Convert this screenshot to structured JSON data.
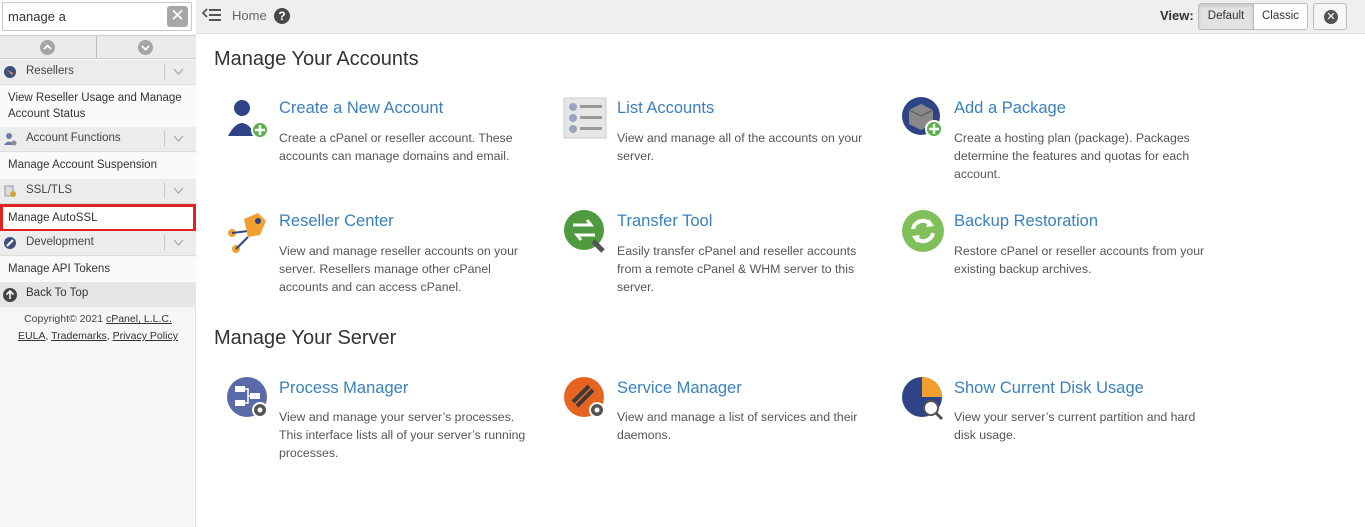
{
  "sidebar": {
    "search_value": "manage a",
    "categories": [
      {
        "label": "Resellers",
        "item": "View Reseller Usage and Manage Account Status"
      },
      {
        "label": "Account Functions",
        "item": "Manage Account Suspension"
      },
      {
        "label": "SSL/TLS",
        "item": "Manage AutoSSL"
      },
      {
        "label": "Development",
        "item": "Manage API Tokens"
      }
    ],
    "back_to_top": "Back To Top",
    "copyright": "Copyright© 2021",
    "company_link": "cPanel, L.L.C.",
    "footer_links": [
      "EULA",
      "Trademarks",
      "Privacy Policy"
    ]
  },
  "topbar": {
    "breadcrumb": "Home",
    "help_glyph": "?",
    "view_label": "View:",
    "view_options": [
      "Default",
      "Classic"
    ],
    "selected_view": "Default"
  },
  "sections": [
    {
      "title": "Manage Your Accounts",
      "tiles": [
        {
          "title": "Create a New Account",
          "desc": "Create a cPanel or reseller account. These accounts can manage domains and email.",
          "icon": "create-account-icon"
        },
        {
          "title": "List Accounts",
          "desc": "View and manage all of the accounts on your server.",
          "icon": "list-accounts-icon"
        },
        {
          "title": "Add a Package",
          "desc": "Create a hosting plan (package). Packages determine the features and quotas for each account.",
          "icon": "add-package-icon"
        },
        {
          "title": "Reseller Center",
          "desc": "View and manage reseller accounts on your server. Resellers manage other cPanel accounts and can access cPanel.",
          "icon": "reseller-center-icon"
        },
        {
          "title": "Transfer Tool",
          "desc": "Easily transfer cPanel and reseller accounts from a remote cPanel & WHM server to this server.",
          "icon": "transfer-tool-icon"
        },
        {
          "title": "Backup Restoration",
          "desc": "Restore cPanel or reseller accounts from your existing backup archives.",
          "icon": "backup-restoration-icon"
        }
      ]
    },
    {
      "title": "Manage Your Server",
      "tiles": [
        {
          "title": "Process Manager",
          "desc": "View and manage your server’s processes. This interface lists all of your server’s running processes.",
          "icon": "process-manager-icon"
        },
        {
          "title": "Service Manager",
          "desc": "View and manage a list of services and their daemons.",
          "icon": "service-manager-icon"
        },
        {
          "title": "Show Current Disk Usage",
          "desc": "View your server’s current partition and hard disk usage.",
          "icon": "disk-usage-icon"
        }
      ]
    }
  ],
  "colors": {
    "link": "#3a80c0",
    "highlight": "#e02323"
  }
}
